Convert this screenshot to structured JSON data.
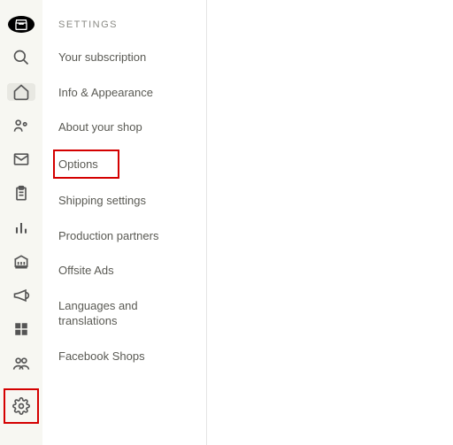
{
  "panel": {
    "heading": "SETTINGS",
    "items": [
      {
        "label": "Your subscription"
      },
      {
        "label": "Info & Appearance"
      },
      {
        "label": "About your shop"
      },
      {
        "label": "Options"
      },
      {
        "label": "Shipping settings"
      },
      {
        "label": "Production partners"
      },
      {
        "label": "Offsite Ads"
      },
      {
        "label": "Languages and translations"
      },
      {
        "label": "Facebook Shops"
      }
    ]
  },
  "highlight_color": "#d40000"
}
